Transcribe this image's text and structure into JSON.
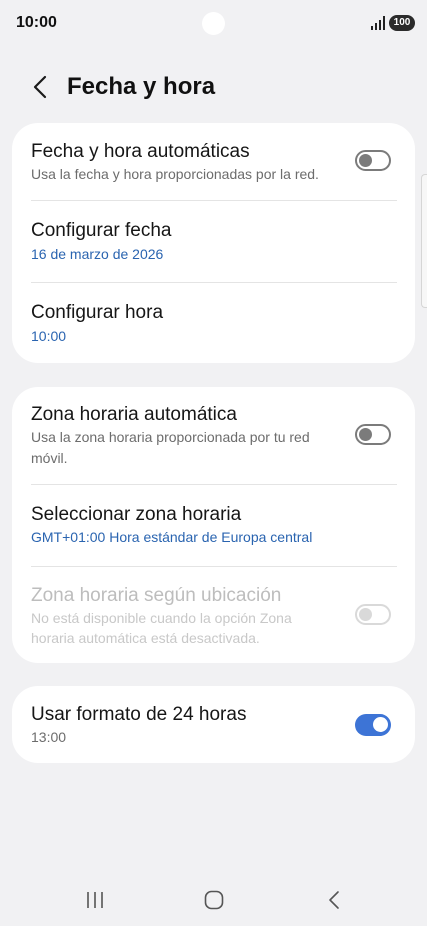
{
  "status_bar": {
    "time": "10:00",
    "battery": "100",
    "icons": [
      "signal-icon",
      "battery-icon"
    ]
  },
  "header": {
    "title": "Fecha y hora",
    "back_icon": "chevron-left-icon"
  },
  "section_1": {
    "auto_datetime": {
      "title": "Fecha y hora automáticas",
      "subtitle": "Usa la fecha y hora proporcionadas por la red.",
      "enabled": false
    },
    "set_date": {
      "title": "Configurar fecha",
      "value": "16 de marzo de 2026"
    },
    "set_time": {
      "title": "Configurar hora",
      "value": "10:00"
    }
  },
  "section_2": {
    "auto_timezone": {
      "title": "Zona horaria automática",
      "subtitle_line1": "Usa la zona horaria proporcionada por tu red",
      "subtitle_line2": "móvil.",
      "enabled": false
    },
    "select_timezone": {
      "title": "Seleccionar zona horaria",
      "value": "GMT+01:00 Hora estándar de Europa central"
    },
    "location_timezone": {
      "title": "Zona horaria según ubicación",
      "subtitle_line1": "No está disponible cuando la opción Zona",
      "subtitle_line2": "horaria automática está desactivada.",
      "enabled": false,
      "disabled": true
    }
  },
  "section_3": {
    "format_24h": {
      "title": "Usar formato de 24 horas",
      "value": "13:00",
      "enabled": true
    }
  },
  "nav_bar": {
    "icons": [
      "recent-apps-icon",
      "home-icon",
      "back-icon"
    ]
  },
  "colors": {
    "background": "#f1f1f3",
    "card": "#ffffff",
    "accent_blue": "#2a64b0",
    "toggle_on": "#3d74d6",
    "toggle_off": "#7b7b7b"
  }
}
